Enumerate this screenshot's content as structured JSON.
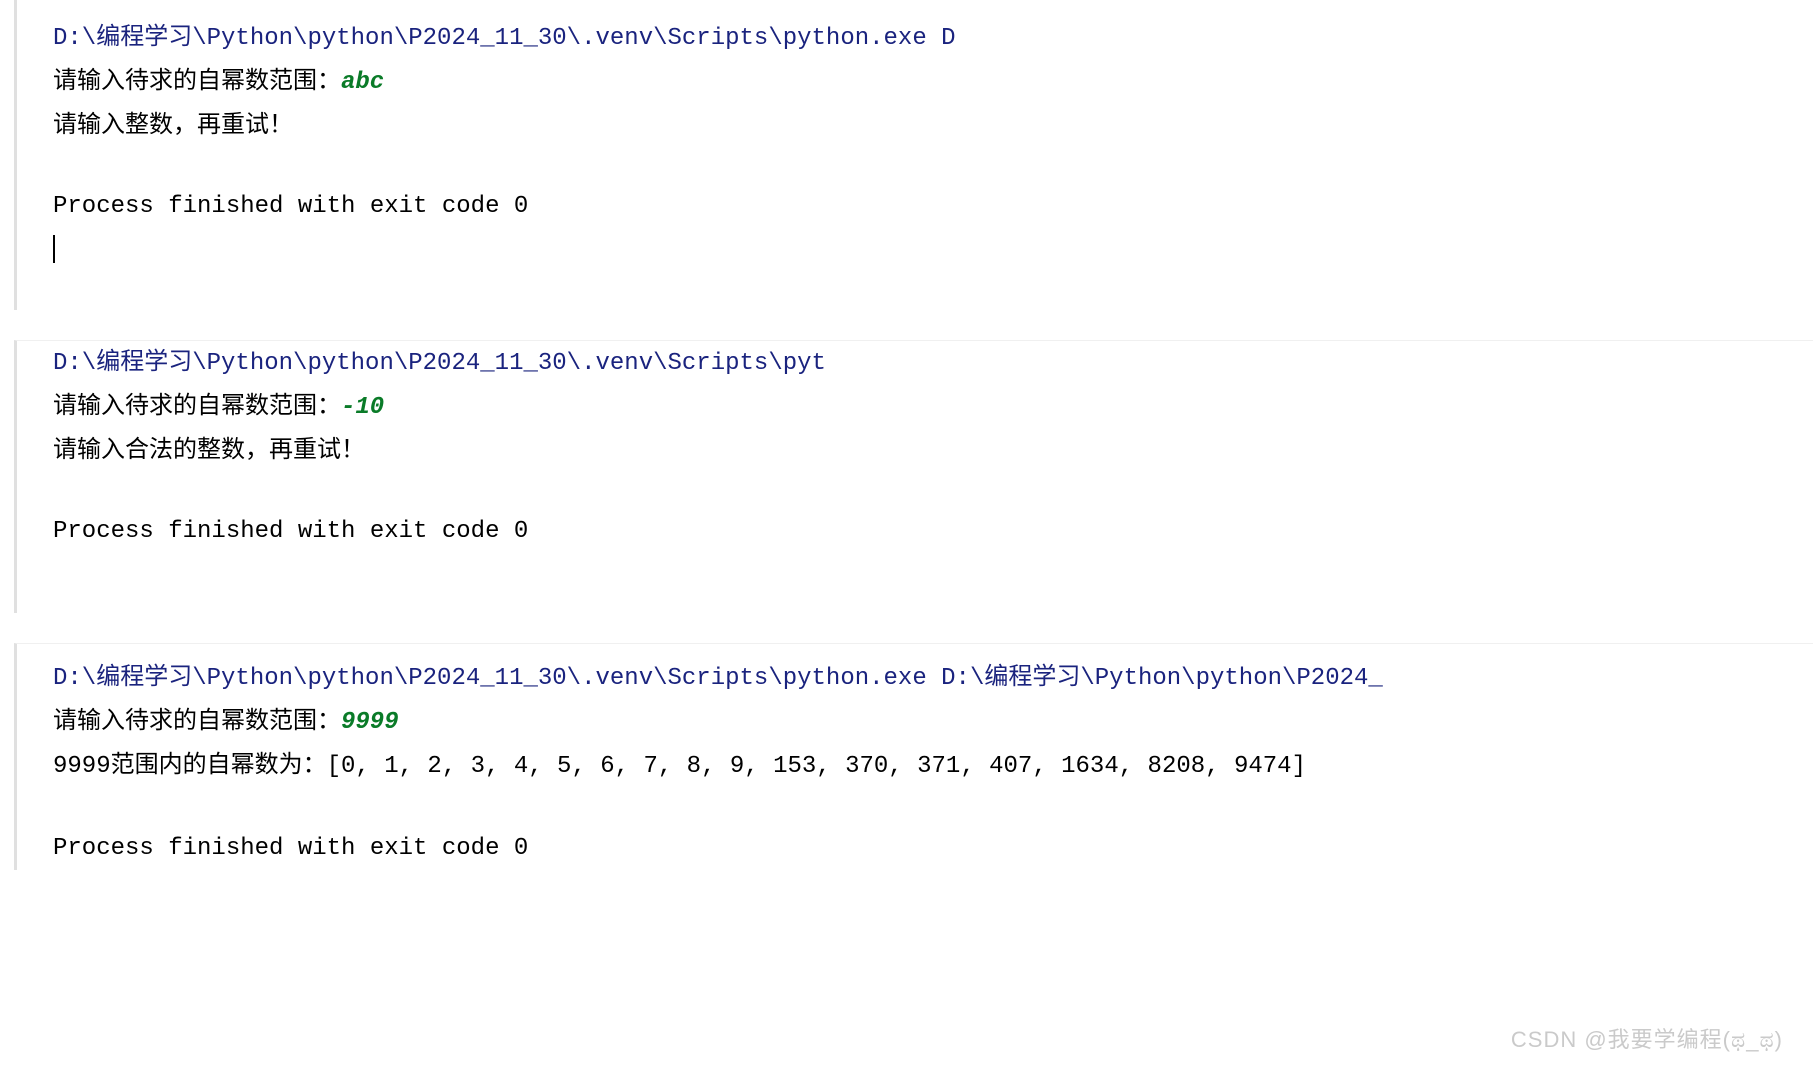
{
  "block1": {
    "path_pre": "D:\\",
    "path_cjk": "编程学习",
    "path_post": "\\Python\\python\\P2024_11_30\\.venv\\Scripts\\python.exe D",
    "prompt": "请输入待求的自幂数范围：",
    "input": "abc",
    "response": "请输入整数，再重试！",
    "exit": "Process finished with exit code 0"
  },
  "block2": {
    "path_pre": "D:\\",
    "path_cjk": "编程学习",
    "path_post": "\\Python\\python\\P2024_11_30\\.venv\\Scripts\\pyt",
    "prompt": "请输入待求的自幂数范围：",
    "input": "-10",
    "response": "请输入合法的整数，再重试！",
    "exit": "Process finished with exit code 0"
  },
  "block3": {
    "path_pre": "D:\\",
    "path_cjk1": "编程学习",
    "path_mid": "\\Python\\python\\P2024_11_30\\.venv\\Scripts\\python.exe D:\\",
    "path_cjk2": "编程学习",
    "path_post": "\\Python\\python\\P2024_",
    "prompt": "请输入待求的自幂数范围：",
    "input": "9999",
    "result_prefix": "9999",
    "result_cjk": "范围内的自幂数为：",
    "result_list": "[0, 1, 2, 3, 4, 5, 6, 7, 8, 9, 153, 370, 371, 407, 1634, 8208, 9474]",
    "exit": "Process finished with exit code 0"
  },
  "watermark": "CSDN @我要学编程(ಥ_ಥ)"
}
